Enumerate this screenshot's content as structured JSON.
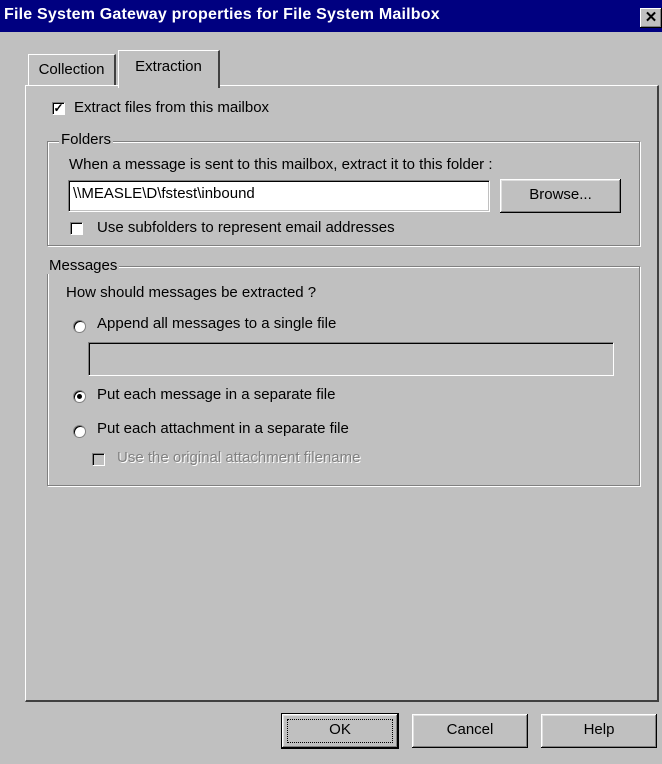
{
  "window": {
    "title": "File System Gateway properties for File System Mailbox",
    "close_glyph": "✕"
  },
  "tabs": [
    {
      "label": "Collection",
      "selected": false
    },
    {
      "label": "Extraction",
      "selected": true
    }
  ],
  "extraction": {
    "extract_files": {
      "label": "Extract files from this mailbox",
      "checked": true
    },
    "folders": {
      "legend": "Folders",
      "prompt": "When a message is sent to this mailbox, extract it to this folder :",
      "path_value": "\\\\MEASLE\\D\\fstest\\inbound",
      "browse_label": "Browse...",
      "use_subfolders": {
        "label": "Use subfolders to represent email addresses",
        "checked": false
      }
    },
    "messages": {
      "legend": "Messages",
      "prompt": "How should messages be extracted ?",
      "options": [
        {
          "label": "Append all messages to a single file",
          "selected": false
        },
        {
          "label": "Put each message in a separate file",
          "selected": true
        },
        {
          "label": "Put each attachment in a separate file",
          "selected": false
        }
      ],
      "single_file_value": "",
      "use_original_filename": {
        "label": "Use the original attachment filename",
        "checked": false,
        "enabled": false
      }
    }
  },
  "buttons": {
    "ok": "OK",
    "cancel": "Cancel",
    "help": "Help"
  },
  "colors": {
    "title_bar": "#000080",
    "face": "#c0c0c0"
  }
}
